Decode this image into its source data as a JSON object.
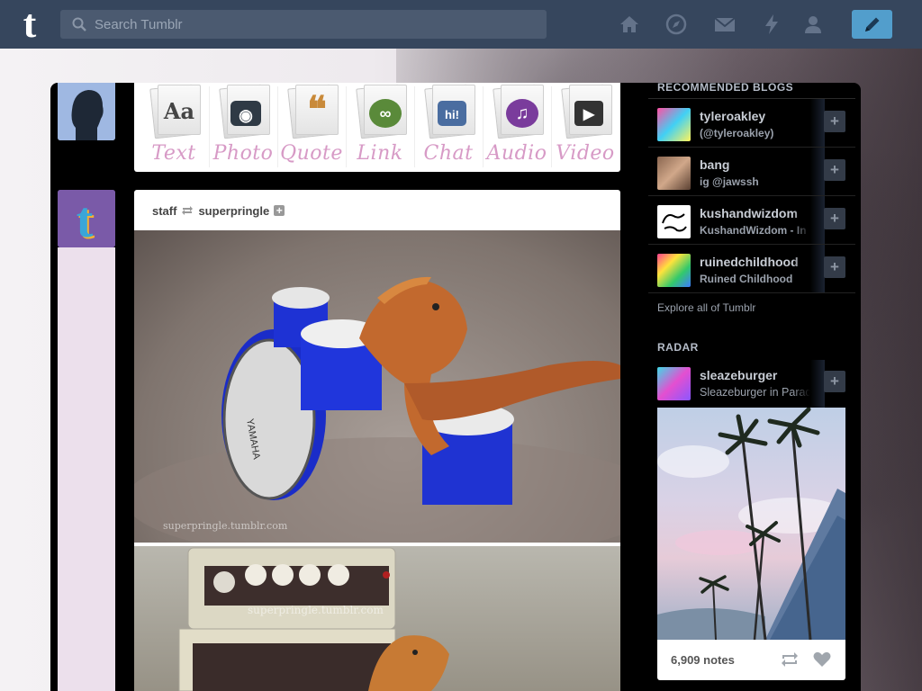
{
  "header": {
    "logo": "t",
    "search_placeholder": "Search Tumblr",
    "nav_icons": [
      "home-icon",
      "explore-icon",
      "inbox-icon",
      "activity-icon",
      "account-icon"
    ],
    "compose_icon": "pencil-icon"
  },
  "post_types": [
    {
      "label": "Text",
      "glyph": "Aa",
      "color": "#444444"
    },
    {
      "label": "Photo",
      "glyph": "◉",
      "color": "#2f3a45"
    },
    {
      "label": "Quote",
      "glyph": "❝",
      "color": "#c98a3a"
    },
    {
      "label": "Link",
      "glyph": "∞",
      "color": "#5a8a3a"
    },
    {
      "label": "Chat",
      "glyph": "hi!",
      "color": "#4a6da0"
    },
    {
      "label": "Audio",
      "glyph": "♫",
      "color": "#7a3c9c"
    },
    {
      "label": "Video",
      "glyph": "▶",
      "color": "#333333"
    }
  ],
  "post": {
    "reblogger": "staff",
    "source": "superpringle",
    "watermark_1": "superpringle.tumblr.com",
    "watermark_2": "superpringle.tumblr.com"
  },
  "sidebar": {
    "recommended_heading": "RECOMMENDED BLOGS",
    "blogs": [
      {
        "name": "tyleroakley",
        "subtitle": "(@tyleroakley)"
      },
      {
        "name": "bang",
        "subtitle": "ig @jawssh"
      },
      {
        "name": "kushandwizdom",
        "subtitle": "KushandWizdom - In"
      },
      {
        "name": "ruinedchildhood",
        "subtitle": "Ruined Childhood"
      }
    ],
    "explore_link": "Explore all of Tumblr",
    "radar_heading": "RADAR",
    "radar_blog": {
      "name": "sleazeburger",
      "subtitle": "Sleazeburger in Paradi"
    },
    "radar_notes": "6,909 notes",
    "follow_label": "+"
  }
}
